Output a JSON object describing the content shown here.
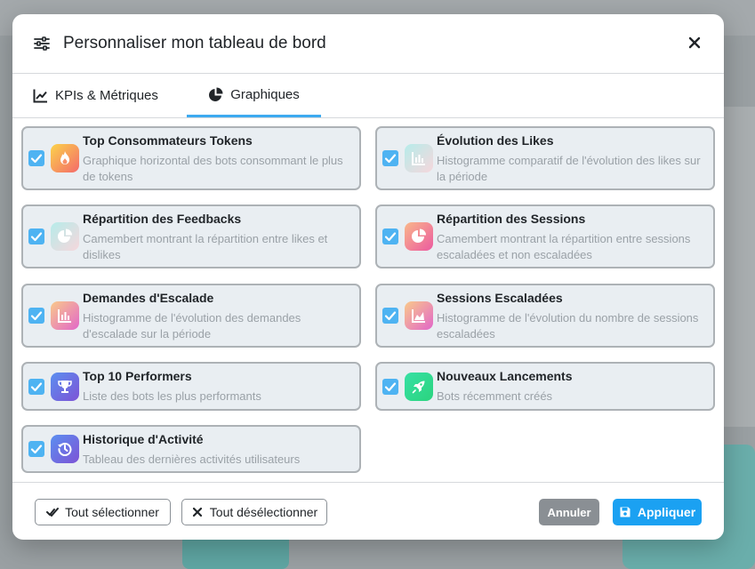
{
  "modal": {
    "title": "Personnaliser mon tableau de bord",
    "tabs": [
      {
        "label": "KPIs & Métriques",
        "active": false
      },
      {
        "label": "Graphiques",
        "active": true
      }
    ]
  },
  "cards": [
    {
      "title": "Top Consommateurs Tokens",
      "desc": "Graphique horizontal des bots consommant le plus de tokens",
      "icon": "fire-icon",
      "checked": true
    },
    {
      "title": "Évolution des Likes",
      "desc": "Histogramme comparatif de l'évolution des likes sur la période",
      "icon": "bar-chart-icon",
      "checked": true
    },
    {
      "title": "Répartition des Feedbacks",
      "desc": "Camembert montrant la répartition entre likes et dislikes",
      "icon": "pie-chart-icon",
      "checked": true
    },
    {
      "title": "Répartition des Sessions",
      "desc": "Camembert montrant la répartition entre sessions escaladées et non escaladées",
      "icon": "pie-chart-icon",
      "checked": true
    },
    {
      "title": "Demandes d'Escalade",
      "desc": "Histogramme de l'évolution des demandes d'escalade sur la période",
      "icon": "bar-chart-icon",
      "checked": true
    },
    {
      "title": "Sessions Escaladées",
      "desc": "Histogramme de l'évolution du nombre de sessions escaladées",
      "icon": "area-chart-icon",
      "checked": true
    },
    {
      "title": "Top 10 Performers",
      "desc": "Liste des bots les plus performants",
      "icon": "trophy-icon",
      "checked": true
    },
    {
      "title": "Nouveaux Lancements",
      "desc": "Bots récemment créés",
      "icon": "rocket-icon",
      "checked": true
    },
    {
      "title": "Historique d'Activité",
      "desc": "Tableau des dernières activités utilisateurs",
      "icon": "history-icon",
      "checked": true
    }
  ],
  "footer": {
    "select_all": "Tout sélectionner",
    "deselect_all": "Tout désélectionner",
    "cancel": "Annuler",
    "apply": "Appliquer"
  },
  "colors": {
    "accent": "#3daaf0",
    "apply_button": "#1ba1f2",
    "cancel_button": "#8a8f94",
    "checkbox": "#4eb3f2"
  }
}
